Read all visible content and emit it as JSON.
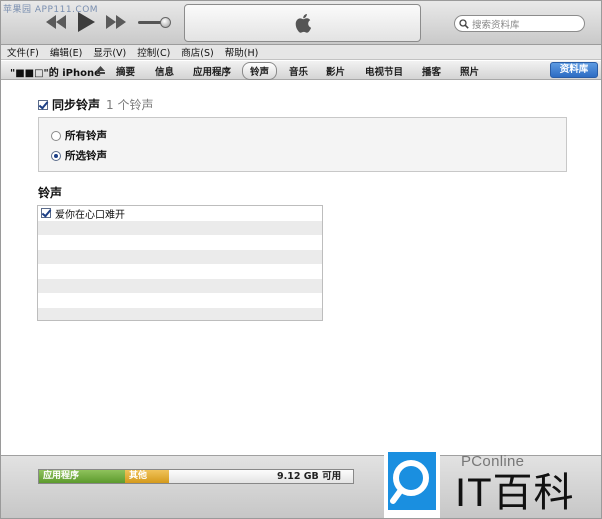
{
  "watermark": "苹果园 APP111.COM",
  "toolbar": {
    "search_placeholder": "搜索资料库"
  },
  "menu": [
    "文件(F)",
    "编辑(E)",
    "显示(V)",
    "控制(C)",
    "商店(S)",
    "帮助(H)"
  ],
  "device": {
    "name": "\"■■□\"的 iPhone",
    "tabs": [
      {
        "label": "摘要",
        "selected": false
      },
      {
        "label": "信息",
        "selected": false
      },
      {
        "label": "应用程序",
        "selected": false
      },
      {
        "label": "铃声",
        "selected": true
      },
      {
        "label": "音乐",
        "selected": false
      },
      {
        "label": "影片",
        "selected": false
      },
      {
        "label": "电视节目",
        "selected": false
      },
      {
        "label": "播客",
        "selected": false
      },
      {
        "label": "照片",
        "selected": false
      }
    ],
    "library_button": "资料库"
  },
  "sync": {
    "label": "同步铃声",
    "count": "1 个铃声",
    "checked": true
  },
  "options": {
    "all": "所有铃声",
    "selected": "所选铃声",
    "current": "selected"
  },
  "ringtones": {
    "title": "铃声",
    "items": [
      {
        "label": "爱你在心口难开",
        "checked": true
      }
    ]
  },
  "capacity": {
    "apps_label": "应用程序",
    "other_label": "其他",
    "free_label": "9.12 GB 可用",
    "apps_color": "#6aa83a",
    "other_color": "#e2ad34"
  },
  "brand": {
    "name": "PConline",
    "it_text": "IT百科"
  }
}
